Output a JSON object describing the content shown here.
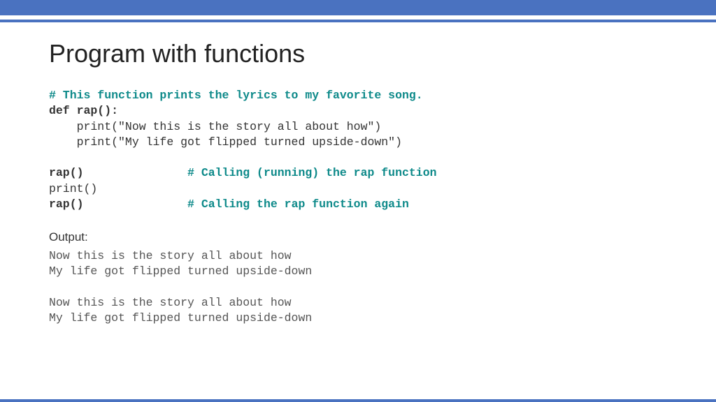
{
  "title": "Program with functions",
  "code": {
    "l1": "# This function prints the lyrics to my favorite song.",
    "l2": "def rap():",
    "l3": "    print(\"Now this is the story all about how\")",
    "l4": "    print(\"My life got flipped turned upside-down\")",
    "l5a": "rap()",
    "l5b": "               # Calling (running) the rap function",
    "l6": "print()",
    "l7a": "rap()",
    "l7b": "               # Calling the rap function again"
  },
  "output_label": "Output:",
  "output": "Now this is the story all about how\nMy life got flipped turned upside-down\n\nNow this is the story all about how\nMy life got flipped turned upside-down"
}
